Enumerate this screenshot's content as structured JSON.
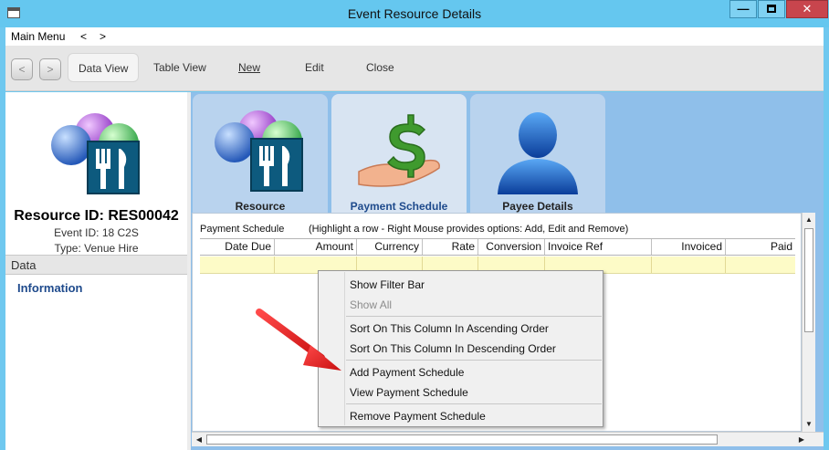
{
  "window": {
    "title": "Event Resource Details",
    "minimize_glyph": "—",
    "close_glyph": "✕"
  },
  "menubar": {
    "main_menu": "Main Menu",
    "back_glyph": "<",
    "forward_glyph": ">"
  },
  "toolbar": {
    "back_glyph": "<",
    "forward_glyph": ">",
    "data_view": "Data View",
    "table_view": "Table View",
    "new": "New",
    "edit": "Edit",
    "close": "Close"
  },
  "left_panel": {
    "resource_id": "Resource ID: RES00042",
    "event_id": "Event ID: 18  C2S",
    "type": "Type: Venue Hire",
    "section_header": "Data",
    "info_link": "Information"
  },
  "tabs": [
    {
      "label": "Resource",
      "icon": "food-resource-icon"
    },
    {
      "label": "Payment Schedule",
      "icon": "money-hand-icon"
    },
    {
      "label": "Payee Details",
      "icon": "person-icon"
    }
  ],
  "schedule": {
    "title": "Payment Schedule",
    "hint": "(Highlight a row - Right Mouse provides options: Add, Edit and Remove)",
    "columns": [
      "Date Due",
      "Amount",
      "Currency",
      "Rate",
      "Conversion",
      "Invoice Ref",
      "Invoiced",
      "Paid"
    ]
  },
  "context_menu": {
    "items": [
      {
        "label": "Show Filter Bar",
        "enabled": true
      },
      {
        "label": "Show All",
        "enabled": false
      },
      {
        "label": "Sort On This Column In Ascending Order",
        "enabled": true
      },
      {
        "label": "Sort On This Column In Descending Order",
        "enabled": true
      },
      {
        "label": "Add Payment Schedule",
        "enabled": true
      },
      {
        "label": "View Payment Schedule",
        "enabled": true
      },
      {
        "label": "Remove Payment Schedule",
        "enabled": true
      }
    ]
  },
  "colors": {
    "title_bar": "#65c7ef",
    "close_button": "#c8454d",
    "selected_row": "#fdfbc7",
    "link": "#1e4a8c",
    "arrow": "#e02020"
  },
  "scrollbars": {
    "up_glyph": "▲",
    "down_glyph": "▼",
    "left_glyph": "◀",
    "right_glyph": "▶"
  }
}
